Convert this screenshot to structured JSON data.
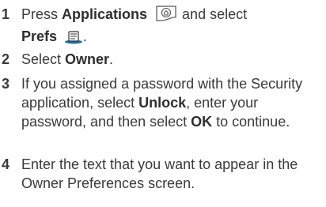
{
  "steps": [
    {
      "number": "1",
      "parts": {
        "t1": "Press ",
        "b1": "Applications",
        "t2": " and select",
        "b2": "Prefs",
        "t3": "."
      },
      "icons": [
        "applications-icon",
        "prefs-icon"
      ]
    },
    {
      "number": "2",
      "parts": {
        "t1": "Select ",
        "b1": "Owner",
        "t2": "."
      }
    },
    {
      "number": "3",
      "parts": {
        "t1": "If you assigned a password with the Security application, select ",
        "b1": "Unlock",
        "t2": ", enter your password, and then select ",
        "b2": "OK",
        "t3": " to continue."
      }
    },
    {
      "number": "4",
      "parts": {
        "t1": "Enter the text that you want to appear in the Owner Preferences screen."
      }
    }
  ]
}
